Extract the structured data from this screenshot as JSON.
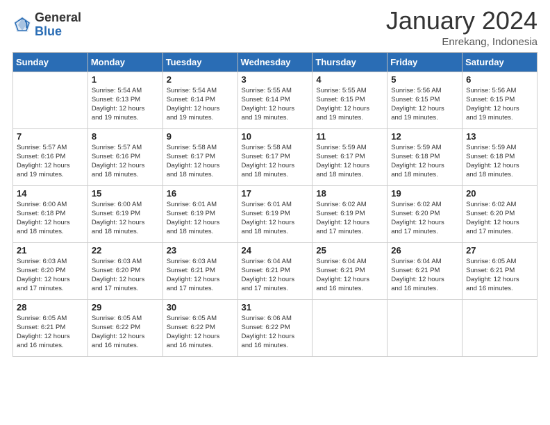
{
  "header": {
    "logo_general": "General",
    "logo_blue": "Blue",
    "month_title": "January 2024",
    "location": "Enrekang, Indonesia"
  },
  "weekdays": [
    "Sunday",
    "Monday",
    "Tuesday",
    "Wednesday",
    "Thursday",
    "Friday",
    "Saturday"
  ],
  "weeks": [
    [
      {
        "day": "",
        "info": ""
      },
      {
        "day": "1",
        "info": "Sunrise: 5:54 AM\nSunset: 6:13 PM\nDaylight: 12 hours\nand 19 minutes."
      },
      {
        "day": "2",
        "info": "Sunrise: 5:54 AM\nSunset: 6:14 PM\nDaylight: 12 hours\nand 19 minutes."
      },
      {
        "day": "3",
        "info": "Sunrise: 5:55 AM\nSunset: 6:14 PM\nDaylight: 12 hours\nand 19 minutes."
      },
      {
        "day": "4",
        "info": "Sunrise: 5:55 AM\nSunset: 6:15 PM\nDaylight: 12 hours\nand 19 minutes."
      },
      {
        "day": "5",
        "info": "Sunrise: 5:56 AM\nSunset: 6:15 PM\nDaylight: 12 hours\nand 19 minutes."
      },
      {
        "day": "6",
        "info": "Sunrise: 5:56 AM\nSunset: 6:15 PM\nDaylight: 12 hours\nand 19 minutes."
      }
    ],
    [
      {
        "day": "7",
        "info": "Sunrise: 5:57 AM\nSunset: 6:16 PM\nDaylight: 12 hours\nand 19 minutes."
      },
      {
        "day": "8",
        "info": "Sunrise: 5:57 AM\nSunset: 6:16 PM\nDaylight: 12 hours\nand 18 minutes."
      },
      {
        "day": "9",
        "info": "Sunrise: 5:58 AM\nSunset: 6:17 PM\nDaylight: 12 hours\nand 18 minutes."
      },
      {
        "day": "10",
        "info": "Sunrise: 5:58 AM\nSunset: 6:17 PM\nDaylight: 12 hours\nand 18 minutes."
      },
      {
        "day": "11",
        "info": "Sunrise: 5:59 AM\nSunset: 6:17 PM\nDaylight: 12 hours\nand 18 minutes."
      },
      {
        "day": "12",
        "info": "Sunrise: 5:59 AM\nSunset: 6:18 PM\nDaylight: 12 hours\nand 18 minutes."
      },
      {
        "day": "13",
        "info": "Sunrise: 5:59 AM\nSunset: 6:18 PM\nDaylight: 12 hours\nand 18 minutes."
      }
    ],
    [
      {
        "day": "14",
        "info": "Sunrise: 6:00 AM\nSunset: 6:18 PM\nDaylight: 12 hours\nand 18 minutes."
      },
      {
        "day": "15",
        "info": "Sunrise: 6:00 AM\nSunset: 6:19 PM\nDaylight: 12 hours\nand 18 minutes."
      },
      {
        "day": "16",
        "info": "Sunrise: 6:01 AM\nSunset: 6:19 PM\nDaylight: 12 hours\nand 18 minutes."
      },
      {
        "day": "17",
        "info": "Sunrise: 6:01 AM\nSunset: 6:19 PM\nDaylight: 12 hours\nand 18 minutes."
      },
      {
        "day": "18",
        "info": "Sunrise: 6:02 AM\nSunset: 6:19 PM\nDaylight: 12 hours\nand 17 minutes."
      },
      {
        "day": "19",
        "info": "Sunrise: 6:02 AM\nSunset: 6:20 PM\nDaylight: 12 hours\nand 17 minutes."
      },
      {
        "day": "20",
        "info": "Sunrise: 6:02 AM\nSunset: 6:20 PM\nDaylight: 12 hours\nand 17 minutes."
      }
    ],
    [
      {
        "day": "21",
        "info": "Sunrise: 6:03 AM\nSunset: 6:20 PM\nDaylight: 12 hours\nand 17 minutes."
      },
      {
        "day": "22",
        "info": "Sunrise: 6:03 AM\nSunset: 6:20 PM\nDaylight: 12 hours\nand 17 minutes."
      },
      {
        "day": "23",
        "info": "Sunrise: 6:03 AM\nSunset: 6:21 PM\nDaylight: 12 hours\nand 17 minutes."
      },
      {
        "day": "24",
        "info": "Sunrise: 6:04 AM\nSunset: 6:21 PM\nDaylight: 12 hours\nand 17 minutes."
      },
      {
        "day": "25",
        "info": "Sunrise: 6:04 AM\nSunset: 6:21 PM\nDaylight: 12 hours\nand 16 minutes."
      },
      {
        "day": "26",
        "info": "Sunrise: 6:04 AM\nSunset: 6:21 PM\nDaylight: 12 hours\nand 16 minutes."
      },
      {
        "day": "27",
        "info": "Sunrise: 6:05 AM\nSunset: 6:21 PM\nDaylight: 12 hours\nand 16 minutes."
      }
    ],
    [
      {
        "day": "28",
        "info": "Sunrise: 6:05 AM\nSunset: 6:21 PM\nDaylight: 12 hours\nand 16 minutes."
      },
      {
        "day": "29",
        "info": "Sunrise: 6:05 AM\nSunset: 6:22 PM\nDaylight: 12 hours\nand 16 minutes."
      },
      {
        "day": "30",
        "info": "Sunrise: 6:05 AM\nSunset: 6:22 PM\nDaylight: 12 hours\nand 16 minutes."
      },
      {
        "day": "31",
        "info": "Sunrise: 6:06 AM\nSunset: 6:22 PM\nDaylight: 12 hours\nand 16 minutes."
      },
      {
        "day": "",
        "info": ""
      },
      {
        "day": "",
        "info": ""
      },
      {
        "day": "",
        "info": ""
      }
    ]
  ]
}
